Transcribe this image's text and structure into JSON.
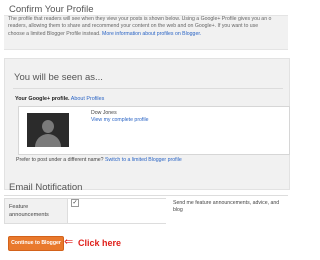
{
  "confirm": {
    "title": "Confirm Your Profile",
    "desc_line1_pre": "The profile that readers will see when they view your posts is shown below. Using a Google+ Profile gives you an o",
    "desc_line2": "readers, allowing them to share and recommend your content on the web and on Google+. If you want to use",
    "desc_line3_pre": "choose a limited Blogger Profile instead. ",
    "desc_line3_link": "More information about profiles on Blogger."
  },
  "seen": {
    "title": "You will be seen as...",
    "gplus_label": "Your Google+ profile.",
    "about_link": "About Profiles",
    "profile_name": "Dow Jones",
    "profile_link": "View my complete profile",
    "prefer_text": "Prefer to post under a different name?",
    "switch_link": "Switch to a limited Blogger profile"
  },
  "email": {
    "title": "Email Notification",
    "feature_label_1": "Feature",
    "feature_label_2": "announcements",
    "checkbox_mark": "✓",
    "send_line1": "Send me feature announcements, advice, and",
    "send_line2": "blog"
  },
  "actions": {
    "continue_label": "Continue to Blogger",
    "arrow_glyph": "⇐",
    "click_here": "Click here"
  }
}
